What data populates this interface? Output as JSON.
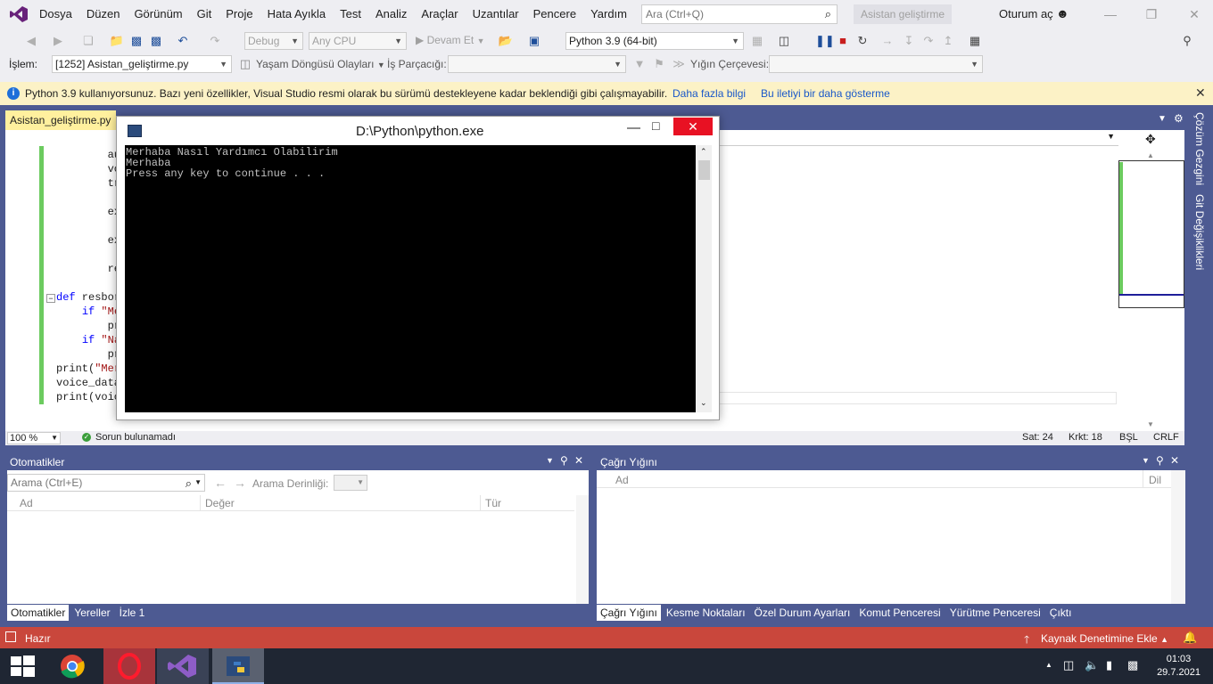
{
  "menu": {
    "items": [
      "Dosya",
      "Düzen",
      "Görünüm",
      "Git",
      "Proje",
      "Hata Ayıkla",
      "Test",
      "Analiz",
      "Araçlar",
      "Uzantılar",
      "Pencere",
      "Yardım"
    ],
    "search_placeholder": "Ara (Ctrl+Q)",
    "assistant": "Asistan geliştirme",
    "signin": "Oturum aç"
  },
  "toolbar": {
    "config": "Debug",
    "platform": "Any CPU",
    "continue": "Devam Et",
    "python_env": "Python 3.9 (64-bit)",
    "process_label": "İşlem:",
    "process_value": "[1252] Asistan_geliştirme.py",
    "lifecycle": "Yaşam Döngüsü Olayları",
    "thread_label": "İş Parçacığı:",
    "stack_frame_label": "Yığın Çerçevesi:"
  },
  "infobar": {
    "message": "Python 3.9 kullanıyorsunuz. Bazı yeni özellikler, Visual Studio resmi olarak bu sürümü destekleyene kadar beklendiği gibi çalışmayabilir.",
    "link_more": "Daha fazla bilgi",
    "link_hide": "Bu iletiyi bir daha gösterme"
  },
  "editor": {
    "tab_label": "Asistan_geliştirme.py",
    "code_lines": [
      {
        "indent": "        ",
        "text": "au"
      },
      {
        "indent": "        ",
        "text": "vo"
      },
      {
        "indent": "        ",
        "text": "tr"
      },
      {
        "indent": "",
        "text": ""
      },
      {
        "indent": "        ",
        "text": "ex"
      },
      {
        "indent": "",
        "text": ""
      },
      {
        "indent": "        ",
        "text": "ex"
      },
      {
        "indent": "",
        "text": ""
      },
      {
        "indent": "        ",
        "text": "re"
      },
      {
        "indent": "",
        "text": ""
      },
      {
        "indent": "",
        "text": "def resbor"
      },
      {
        "indent": "    ",
        "text": "if \"Me"
      },
      {
        "indent": "        ",
        "text": "pr"
      },
      {
        "indent": "    ",
        "text": "if \"Na"
      },
      {
        "indent": "        ",
        "text": "pr"
      },
      {
        "indent": "",
        "text": "print(\"Mer"
      },
      {
        "indent": "",
        "text": "voice_data"
      },
      {
        "indent": "",
        "text": "print(voic"
      }
    ],
    "zoom": "100 %",
    "issues": "Sorun bulunamadı",
    "line": "Sat: 24",
    "col": "Krkt: 18",
    "indent_mode": "BŞL",
    "eol": "CRLF"
  },
  "side_tabs": [
    "Çözüm Gezgini",
    "Git Değişiklikleri"
  ],
  "console": {
    "title": "D:\\Python\\python.exe",
    "output": "Merhaba Nasıl Yardımcı Olabilirim\nMerhaba\nPress any key to continue . . ."
  },
  "autos_panel": {
    "title": "Otomatikler",
    "search_placeholder": "Arama (Ctrl+E)",
    "depth_label": "Arama Derinliği:",
    "columns": [
      "Ad",
      "Değer",
      "Tür"
    ],
    "tabs": [
      "Otomatikler",
      "Yereller",
      "İzle 1"
    ]
  },
  "callstack_panel": {
    "title": "Çağrı Yığını",
    "columns": [
      "Ad",
      "Dil"
    ],
    "tabs": [
      "Çağrı Yığını",
      "Kesme Noktaları",
      "Özel Durum Ayarları",
      "Komut Penceresi",
      "Yürütme Penceresi",
      "Çıktı"
    ]
  },
  "statusbar": {
    "ready": "Hazır",
    "source_control": "Kaynak Denetimine Ekle"
  },
  "taskbar": {
    "time": "01:03",
    "date": "29.7.2021"
  },
  "colors": {
    "vs_blue": "#4d5a92",
    "statusbar": "#c9473c",
    "infobar": "#fcf2c6",
    "tab_active": "#fff09e"
  }
}
